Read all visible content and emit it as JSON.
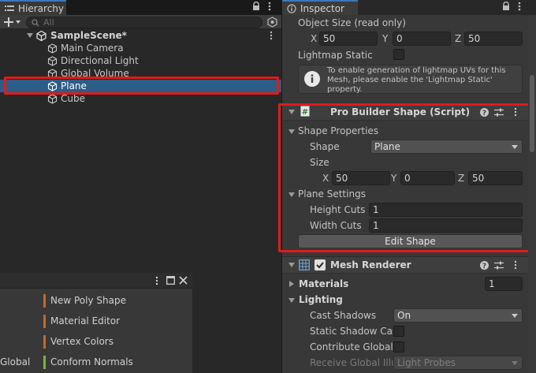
{
  "hierarchy": {
    "tab_label": "Hierarchy",
    "search_placeholder": "All",
    "scene_name": "SampleScene*",
    "objects": [
      "Main Camera",
      "Directional Light",
      "Global Volume",
      "Plane",
      "Cube"
    ],
    "selected": "Plane"
  },
  "tools": {
    "items": [
      {
        "label": "New Poly Shape",
        "color": "#c06a2b"
      },
      {
        "label": "Material Editor",
        "color": "#c06a2b"
      },
      {
        "label": "Vertex Colors",
        "color": "#c06a2b"
      },
      {
        "label": "Conform Normals",
        "color": "#7bb33a"
      }
    ],
    "cut_label": "Global"
  },
  "inspector": {
    "tab_label": "Inspector",
    "object_size_label": "Object Size (read only)",
    "object_size": {
      "x_label": "X",
      "x": "50",
      "y_label": "Y",
      "y": "0",
      "z_label": "Z",
      "z": "50"
    },
    "lightmap_static_label": "Lightmap Static",
    "help_text": "To enable generation of lightmap UVs for this Mesh, please enable the 'Lightmap Static' property.",
    "probuilder": {
      "title": "Pro Builder Shape (Script)",
      "shape_properties_label": "Shape Properties",
      "shape_label": "Shape",
      "shape_value": "Plane",
      "size_label": "Size",
      "size": {
        "x_label": "X",
        "x": "50",
        "y_label": "Y",
        "y": "0",
        "z_label": "Z",
        "z": "50"
      },
      "plane_settings_label": "Plane Settings",
      "height_cuts_label": "Height Cuts",
      "height_cuts": "1",
      "width_cuts_label": "Width Cuts",
      "width_cuts": "1",
      "edit_button": "Edit Shape"
    },
    "mesh_renderer": {
      "title": "Mesh Renderer",
      "materials_label": "Materials",
      "materials_count": "1",
      "lighting_label": "Lighting",
      "cast_shadows_label": "Cast Shadows",
      "cast_shadows_value": "On",
      "static_shadow_label": "Static Shadow Cas",
      "contribute_gi_label": "Contribute Global I",
      "receive_gi_label": "Receive Global Illu",
      "receive_gi_value": "Light Probes"
    }
  },
  "colors": {
    "selection": "#2c5d87",
    "highlight_box": "#e01b1b",
    "tab_accent": "#3a79bb"
  }
}
